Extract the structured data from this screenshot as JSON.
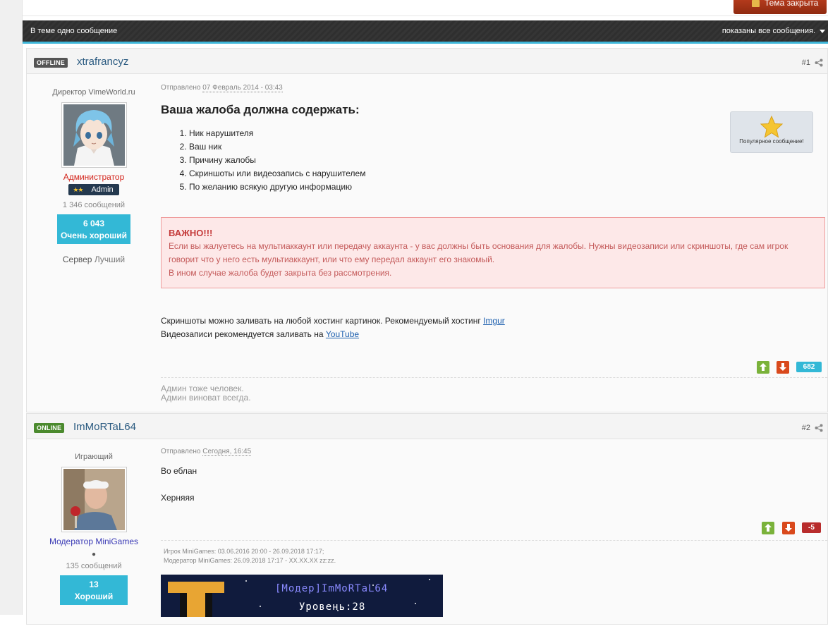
{
  "topic": {
    "closed_label": "Тема закрыта",
    "bar_left": "В теме одно сообщение",
    "bar_right": "показаны все сообщения."
  },
  "posts": [
    {
      "status": "OFFLINE",
      "username": "xtrafrancyz",
      "number": "#1",
      "author": {
        "title": "Директор VimeWorld.ru",
        "role": "Администратор",
        "badge": "Admin",
        "post_count": "1 346 сообщений",
        "rep_value": "6 043",
        "rep_label": "Очень хороший",
        "server_label": "Сервер",
        "server_value": "Лучший"
      },
      "sent_label": "Отправлено",
      "sent_date": "07 Февраль 2014 - 03:43",
      "heading": "Ваша жалоба должна содержать:",
      "list": [
        "Ник нарушителя",
        "Ваш ник",
        "Причину жалобы",
        "Скриншоты или видеозапись с нарушителем",
        "По желанию всякую другую информацию"
      ],
      "popular_label": "Популярное сообщение!",
      "warning": {
        "title": "ВАЖНО!!!",
        "line1": "Если вы жалуетесь на мультиаккаунт или передачу аккаунта - у вас должны быть основания для жалобы. Нужны видеозаписи или скриншоты, где сам игрок",
        "line2": "говорит что у него есть мультиаккаунт, или что ему передал аккаунт его знакомый.",
        "line3": "В ином случае жалоба будет закрыта без рассмотрения."
      },
      "text1": "Скриншоты можно заливать на любой хостинг картинок. Рекомендуемый хостинг",
      "link1": "Imgur",
      "text2": "Видеозаписи рекомендуется заливать на",
      "link2": "YouTube",
      "score": "682",
      "signature": [
        "Админ тоже человек.",
        "Админ виноват всегда."
      ]
    },
    {
      "status": "ONLINE",
      "username": "ImMoRTaL64",
      "number": "#2",
      "author": {
        "title": "Играющий",
        "role": "Модератор MiniGames",
        "dot": "●",
        "post_count": "135 сообщений",
        "rep_value": "13",
        "rep_label": "Хороший"
      },
      "sent_label": "Отправлено",
      "sent_date": "Сегодня, 16:45",
      "line1": "Во еблан",
      "line2": "Херняяя",
      "score": "-5",
      "signature": [
        "Игрок MiniGames: 03.06.2016 20:00 - 26.09.2018 17:17;",
        "Модератор MiniGames: 26.09.2018 17:17 - XX.XX.XX zz:zz."
      ],
      "banner_name": "[Модер]ImMoRTaL64",
      "banner_level": "Уровень:28"
    }
  ]
}
